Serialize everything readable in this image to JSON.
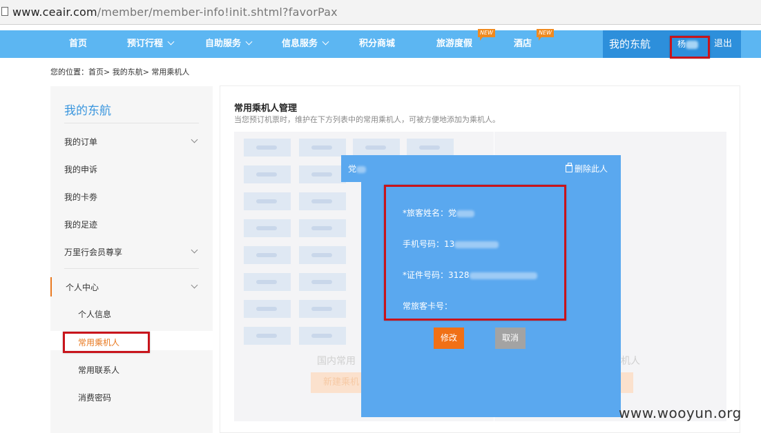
{
  "browser": {
    "url_host": "www.ceair.com",
    "url_path": "/member/member-info!init.shtml?favorPax"
  },
  "nav": {
    "items": [
      {
        "label": "首页"
      },
      {
        "label": "预订行程"
      },
      {
        "label": "自助服务"
      },
      {
        "label": "信息服务"
      },
      {
        "label": "积分商城"
      },
      {
        "label": "旅游度假",
        "badge": "NEW"
      },
      {
        "label": "酒店",
        "badge": "NEW"
      }
    ],
    "my_title": "我的东航",
    "user_name": "杨",
    "logout": "退出"
  },
  "breadcrumb": "您的位置：首页> 我的东航> 常用乘机人",
  "sidebar": {
    "title": "我的东航",
    "items": [
      {
        "label": "我的订单"
      },
      {
        "label": "我的申诉"
      },
      {
        "label": "我的卡劵"
      },
      {
        "label": "我的足迹"
      },
      {
        "label": "万里行会员尊享"
      },
      {
        "label": "个人中心"
      }
    ],
    "subitems": [
      {
        "label": "个人信息"
      },
      {
        "label": "常用乘机人"
      },
      {
        "label": "常用联系人"
      },
      {
        "label": "消费密码"
      }
    ]
  },
  "main": {
    "title": "常用乘机人管理",
    "desc": "当您预订机票时，维护在下方列表中的常用乘机人，可被方便地添加为乘机人。",
    "left_empty": "国内常用",
    "right_empty": "机人",
    "new_button": "新建乘机"
  },
  "modal": {
    "name": "党",
    "delete": "删除此人",
    "fields": {
      "passenger_name": "*旅客姓名：党",
      "phone": "手机号码：13",
      "id_number": "*证件号码：3128",
      "frequent_flyer": "常旅客卡号："
    },
    "edit_button": "修改",
    "cancel_button": "取消"
  },
  "watermark": "www.wooyun.org",
  "colors": {
    "nav": "#5cb6f2",
    "nav_dark": "#2d8fdb",
    "modal": "#5aa8ef",
    "accent": "#f07016",
    "highlight": "#c8141b"
  }
}
